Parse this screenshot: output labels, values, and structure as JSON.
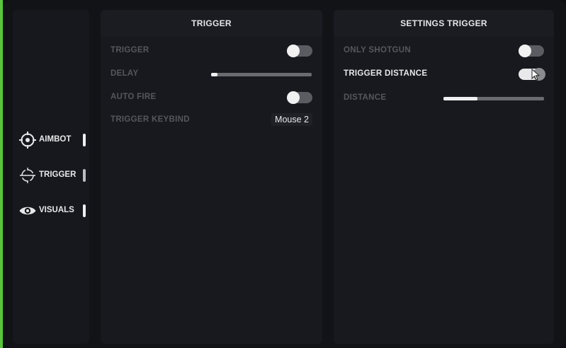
{
  "sidebar": {
    "items": [
      {
        "label": "AIMBOT",
        "icon": "crosshair-icon"
      },
      {
        "label": "TRIGGER",
        "icon": "target-icon"
      },
      {
        "label": "VISUALS",
        "icon": "eye-icon"
      }
    ],
    "active_item": "TRIGGER"
  },
  "trigger_panel": {
    "title": "TRIGGER",
    "trigger_label": "TRIGGER",
    "trigger_enabled": false,
    "delay_label": "DELAY",
    "delay_value_fraction": 0.06,
    "auto_fire_label": "AUTO FIRE",
    "auto_fire_enabled": false,
    "keybind_label": "TRIGGER KEYBIND",
    "keybind_value": "Mouse 2"
  },
  "settings_panel": {
    "title": "SETTINGS TRIGGER",
    "only_shotgun_label": "ONLY SHOTGUN",
    "only_shotgun_enabled": false,
    "trigger_distance_label": "TRIGGER DISTANCE",
    "trigger_distance_enabled": true,
    "distance_label": "DISTANCE",
    "distance_value_fraction": 0.34
  },
  "colors": {
    "background": "#121317",
    "panel": "#18191e",
    "text_active": "#e8e8ea",
    "text_inactive": "#55575e",
    "accent_edge": "#59c53a"
  }
}
